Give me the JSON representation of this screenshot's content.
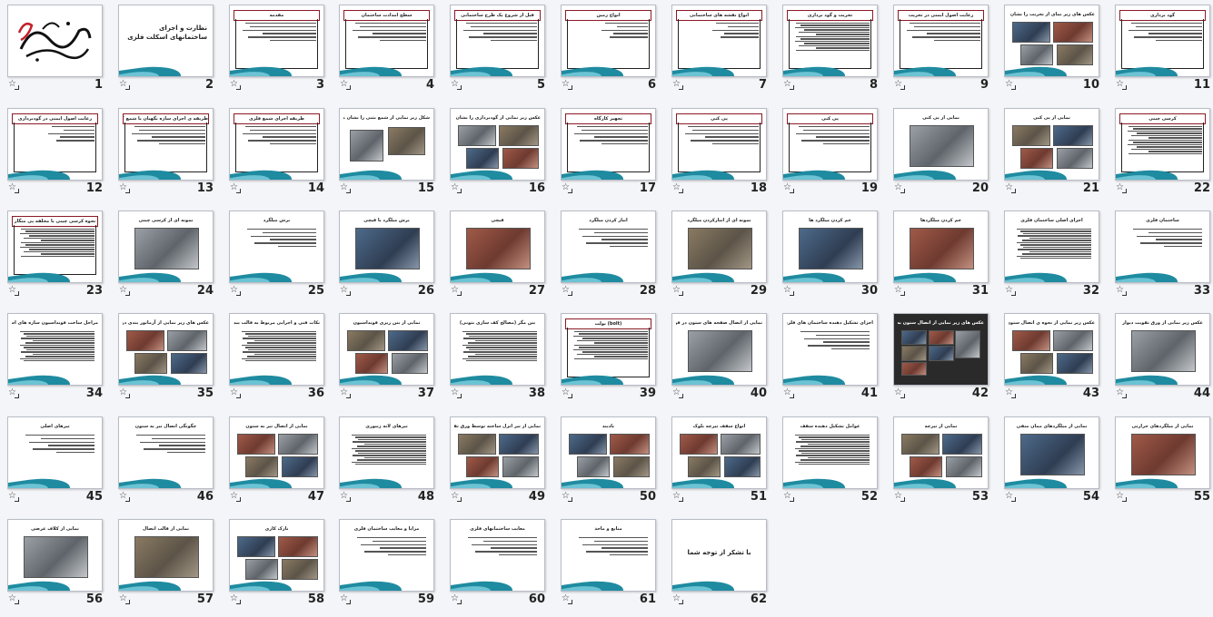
{
  "slides": [
    {
      "num": "1",
      "title": "",
      "style": "calligraphy"
    },
    {
      "num": "2",
      "title": "نظارت و اجرای ساختمانهای اسکلت فلزی",
      "style": "cover"
    },
    {
      "num": "3",
      "title": "مقدمه",
      "style": "boxed-text"
    },
    {
      "num": "4",
      "title": "سطح امدادت ساختمان",
      "style": "boxed-text"
    },
    {
      "num": "5",
      "title": "قبل از شروع یک طرح ساختمانی",
      "style": "boxed-text"
    },
    {
      "num": "6",
      "title": "انواع زمین",
      "style": "boxed-list"
    },
    {
      "num": "7",
      "title": "انواع نقشه های ساختمانی",
      "style": "boxed-list"
    },
    {
      "num": "8",
      "title": "تخریب و گود برداری",
      "style": "boxed-dense"
    },
    {
      "num": "9",
      "title": "رعایت اصول ایمنی در تخریب",
      "style": "boxed-text"
    },
    {
      "num": "10",
      "title": "عکس های زیر نمای از تخریب را نشان میدهد",
      "style": "photos"
    },
    {
      "num": "11",
      "title": "گود برداری",
      "style": "boxed-text"
    },
    {
      "num": "12",
      "title": "رعایت اصول ایمنی در گودبرداری",
      "style": "boxed-list"
    },
    {
      "num": "13",
      "title": "طریقه ی اجرای سازه نگهبان یا شمع کوبی",
      "style": "boxed-text"
    },
    {
      "num": "14",
      "title": "طریقه اجرای شمع فلزی",
      "style": "boxed-text"
    },
    {
      "num": "15",
      "title": "شکل زیر نمایی از شمع بتنی را نشان میدهد",
      "style": "diagram"
    },
    {
      "num": "16",
      "title": "عکس زیر نمایی از گودبرداری را نشان میدهد",
      "style": "photos"
    },
    {
      "num": "17",
      "title": "تجهیز کارگاه",
      "style": "boxed-text"
    },
    {
      "num": "18",
      "title": "پی کنی",
      "style": "boxed-text"
    },
    {
      "num": "19",
      "title": "پی کنی",
      "style": "boxed-text"
    },
    {
      "num": "20",
      "title": "نمایی از پی کنی",
      "style": "photo-one"
    },
    {
      "num": "21",
      "title": "نمایی از پی کنی",
      "style": "photos"
    },
    {
      "num": "22",
      "title": "کرسی چینی",
      "style": "boxed-dense"
    },
    {
      "num": "23",
      "title": "نحوه کرسی چینی با مخلفه پی منگار",
      "style": "boxed-dense"
    },
    {
      "num": "24",
      "title": "نمونه ای از کرسی چینی",
      "style": "photo-one"
    },
    {
      "num": "25",
      "title": "برش میلگرد",
      "style": "text"
    },
    {
      "num": "26",
      "title": "برش میلگرد با قیچی",
      "style": "photo-one"
    },
    {
      "num": "27",
      "title": "قیچی",
      "style": "photo-one"
    },
    {
      "num": "28",
      "title": "انبار کردن میلگرد",
      "style": "text"
    },
    {
      "num": "29",
      "title": "نمونه ای از انبارکردن میلگرد",
      "style": "photo-one"
    },
    {
      "num": "30",
      "title": "خم کردن میلگرد ها",
      "style": "photo-one"
    },
    {
      "num": "31",
      "title": "خم کردن میلگردها",
      "style": "photo-one"
    },
    {
      "num": "32",
      "title": "اجزای اصلی ساختمان فلزی",
      "style": "text-dense"
    },
    {
      "num": "33",
      "title": "ساختمان فلزی",
      "style": "text"
    },
    {
      "num": "34",
      "title": "مراحل ساخت فونداسیون سازه های اسکلت فلزی",
      "style": "text-dense"
    },
    {
      "num": "35",
      "title": "عکس های زیر نمایی از آرماتور بندی در فونداسیون گسترده را نشان میدهد",
      "style": "photos"
    },
    {
      "num": "36",
      "title": "نکات فنی و اجرایی مربوط به قالب بندی",
      "style": "text-dense"
    },
    {
      "num": "37",
      "title": "نمایی از بتن ریزی فونداسیون",
      "style": "photos"
    },
    {
      "num": "38",
      "title": "بتن مگر (مصالح کف سازی بتونی)",
      "style": "text-dense"
    },
    {
      "num": "39",
      "title": "(bolt) بولت",
      "style": "boxed-dense"
    },
    {
      "num": "40",
      "title": "نمایی از اتصال صفحه های ستون در فونداسیون",
      "style": "photo-one"
    },
    {
      "num": "41",
      "title": "اجزای تشکیل دهنده ساختمان های فلزی",
      "style": "text"
    },
    {
      "num": "42",
      "title": "عکس های زیر نمایی از اتصال ستون به صفحات زیر ستون را نشان میدهد",
      "style": "dark-photos"
    },
    {
      "num": "43",
      "title": "عکس زیر نمایی از نحوه ی اتصال ستون را نشان میدهد",
      "style": "photos"
    },
    {
      "num": "44",
      "title": "عکس زیر نمایی از ورق تقویت دیوار",
      "style": "photo-one"
    },
    {
      "num": "45",
      "title": "تیرهای اصلی",
      "style": "text"
    },
    {
      "num": "46",
      "title": "چگونگی اتصال تیر به ستون",
      "style": "text"
    },
    {
      "num": "47",
      "title": "نمایی از اتصال تیر به ستون",
      "style": "photos"
    },
    {
      "num": "48",
      "title": "تیرهای لانه زنبوری",
      "style": "text-dense"
    },
    {
      "num": "49",
      "title": "نمایی از تیر انزل ساخته توسط ورق تقویت شده",
      "style": "photos"
    },
    {
      "num": "50",
      "title": "بادبند",
      "style": "photos"
    },
    {
      "num": "51",
      "title": "انواع سقف تیرچه بلوک",
      "style": "photos"
    },
    {
      "num": "52",
      "title": "عوامل تشکیل دهنده سقف",
      "style": "text-dense"
    },
    {
      "num": "53",
      "title": "نمایی از تیرچه",
      "style": "photos"
    },
    {
      "num": "54",
      "title": "نمایی از میلگردهای ممان منفی",
      "style": "photo-one"
    },
    {
      "num": "55",
      "title": "نمایی از میلگردهای حرارتی",
      "style": "photo-one"
    },
    {
      "num": "56",
      "title": "نمایی از کلاف عرضی",
      "style": "photo-one"
    },
    {
      "num": "57",
      "title": "نمایی از قالب اتصال",
      "style": "photo-one"
    },
    {
      "num": "58",
      "title": "نازک کاری",
      "style": "photos"
    },
    {
      "num": "59",
      "title": "مزایا و معایب ساختمان فلزی",
      "style": "text"
    },
    {
      "num": "60",
      "title": "معایب ساختمانهای فلزی",
      "style": "text"
    },
    {
      "num": "61",
      "title": "منابع و ماخذ",
      "style": "text"
    },
    {
      "num": "62",
      "title": "با تشکر از توجه شما",
      "style": "thanks"
    }
  ],
  "colors": {
    "accent": "#1f8ba0",
    "accentLight": "#6cc3d3",
    "titleBorder": "#8a1a26",
    "background": "#f4f5f8"
  },
  "icons": {
    "star": "star-icon",
    "transition": "slide-transition-icon"
  }
}
